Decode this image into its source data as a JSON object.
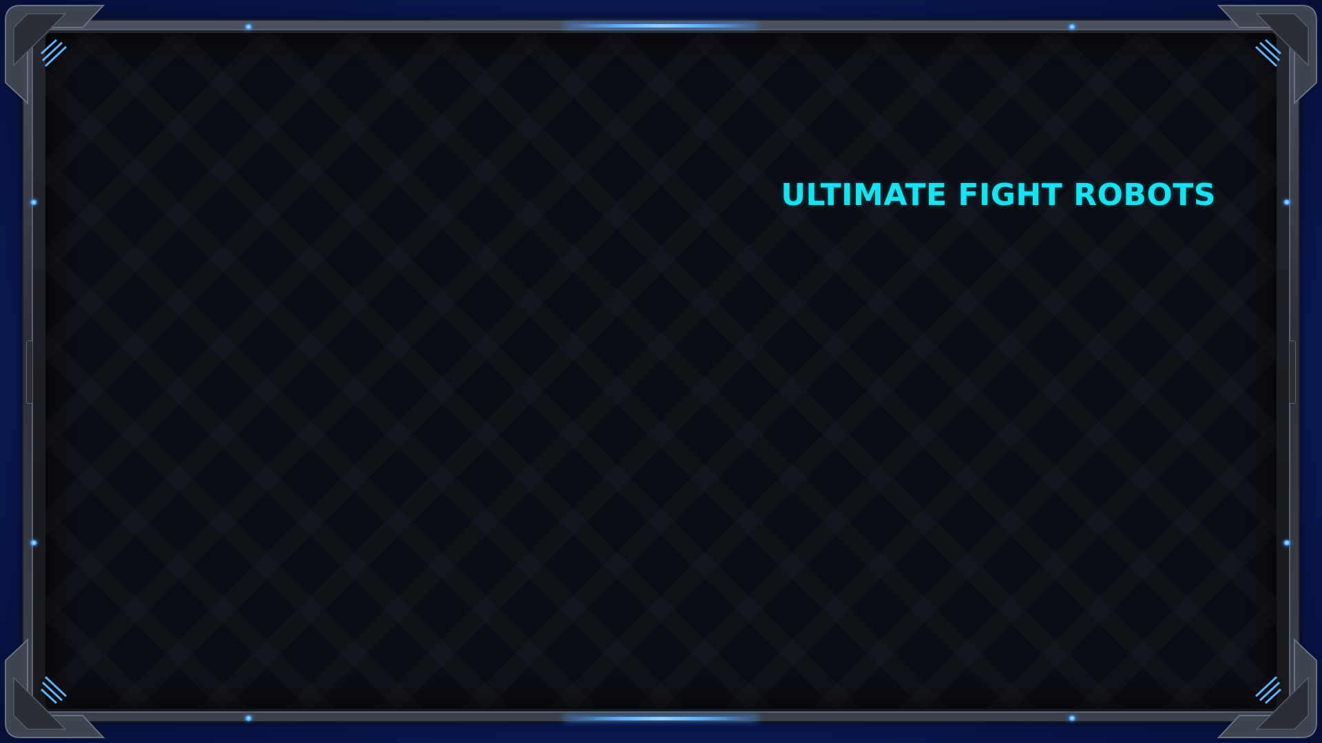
{
  "screen": {
    "title": "ULTIMATE FIGHT ROBOTS"
  },
  "colors": {
    "title": "#14e4f2",
    "panel": "#0b0d14",
    "background": "#0a1a55",
    "frame_metal": "#3c424e",
    "accent_glow": "#5fb2ff"
  },
  "icons": {
    "corner_bracket": "corner-bracket-icon",
    "indicator_light": "indicator-light-icon"
  }
}
